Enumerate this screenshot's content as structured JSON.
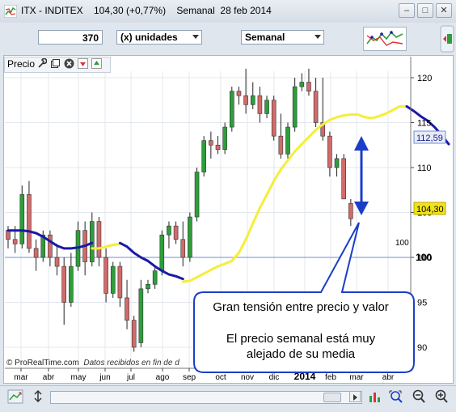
{
  "window": {
    "title": "ITX - INDITEX    104,30 (+0,77%)    Semanal  28 feb 2014",
    "minimize": "–",
    "maximize": "□",
    "close": "✕"
  },
  "toolbar": {
    "quantity": "370",
    "units_combo": "(x) unidades",
    "period_combo": "Semanal",
    "indicator_button_icon": "indicators-icon"
  },
  "panel": {
    "label": "Precio",
    "icons": [
      "wrench-icon",
      "window-icon",
      "close-icon",
      "arrow-down-icon",
      "arrow-up-icon"
    ]
  },
  "price_axis": {
    "ticks": [
      "120",
      "115",
      "110",
      "105",
      "100",
      "95",
      "90"
    ],
    "current_price_label": "104,30",
    "ma_label": "112,59",
    "ref_line_label": "100",
    "ref_line_label_right": "100"
  },
  "time_axis": {
    "labels": [
      "mar",
      "abr",
      "may",
      "jun",
      "jul",
      "ago",
      "sep",
      "oct",
      "nov",
      "dic",
      "2014",
      "feb",
      "mar",
      "abr"
    ]
  },
  "copyright": {
    "brand": "© ProRealTime.com",
    "note": "Datos recibidos en fin de d"
  },
  "callout": {
    "line1": "Gran tensión entre precio y valor",
    "line2": "El precio semanal está muy",
    "line3": "alejado de su media"
  },
  "colors": {
    "bull": "#2e9e3a",
    "bear": "#d26a6a",
    "ma_blue": "#1a1aa6",
    "ma_yellow": "#f5ee3a",
    "arrow": "#1a3ec8",
    "ref_line": "#6f8fd6"
  },
  "chart_data": {
    "type": "candlestick",
    "title": "ITX - INDITEX",
    "ylim": [
      88,
      122
    ],
    "reference_level": 100,
    "candles": [
      {
        "o": 103.0,
        "h": 103.5,
        "l": 101.0,
        "c": 102.0
      },
      {
        "o": 102.0,
        "h": 103.5,
        "l": 100.5,
        "c": 101.5
      },
      {
        "o": 101.5,
        "h": 108.0,
        "l": 101.0,
        "c": 107.0
      },
      {
        "o": 107.0,
        "h": 108.5,
        "l": 100.5,
        "c": 101.0
      },
      {
        "o": 101.0,
        "h": 102.0,
        "l": 98.5,
        "c": 100.0
      },
      {
        "o": 100.0,
        "h": 103.0,
        "l": 99.5,
        "c": 102.5
      },
      {
        "o": 102.5,
        "h": 103.0,
        "l": 99.0,
        "c": 100.0
      },
      {
        "o": 100.0,
        "h": 101.5,
        "l": 98.0,
        "c": 99.0
      },
      {
        "o": 99.0,
        "h": 100.0,
        "l": 92.5,
        "c": 95.0
      },
      {
        "o": 95.0,
        "h": 100.5,
        "l": 94.5,
        "c": 99.0
      },
      {
        "o": 99.0,
        "h": 104.0,
        "l": 98.5,
        "c": 103.0
      },
      {
        "o": 103.0,
        "h": 104.0,
        "l": 98.0,
        "c": 99.5
      },
      {
        "o": 99.5,
        "h": 105.0,
        "l": 99.0,
        "c": 104.0
      },
      {
        "o": 104.0,
        "h": 104.5,
        "l": 99.0,
        "c": 100.0
      },
      {
        "o": 100.0,
        "h": 101.0,
        "l": 95.0,
        "c": 96.0
      },
      {
        "o": 96.0,
        "h": 99.5,
        "l": 95.5,
        "c": 99.0
      },
      {
        "o": 99.0,
        "h": 99.5,
        "l": 94.5,
        "c": 95.5
      },
      {
        "o": 95.5,
        "h": 97.5,
        "l": 92.0,
        "c": 93.0
      },
      {
        "o": 93.0,
        "h": 93.5,
        "l": 89.5,
        "c": 90.0
      },
      {
        "o": 90.5,
        "h": 97.5,
        "l": 90.0,
        "c": 96.5
      },
      {
        "o": 96.5,
        "h": 97.5,
        "l": 96.0,
        "c": 97.0
      },
      {
        "o": 97.0,
        "h": 99.0,
        "l": 96.5,
        "c": 98.5
      },
      {
        "o": 98.5,
        "h": 103.0,
        "l": 98.0,
        "c": 102.5
      },
      {
        "o": 102.5,
        "h": 104.0,
        "l": 101.0,
        "c": 103.5
      },
      {
        "o": 103.5,
        "h": 104.0,
        "l": 101.5,
        "c": 102.0
      },
      {
        "o": 102.0,
        "h": 104.0,
        "l": 99.0,
        "c": 100.0
      },
      {
        "o": 100.0,
        "h": 105.0,
        "l": 99.5,
        "c": 104.5
      },
      {
        "o": 104.5,
        "h": 110.0,
        "l": 104.0,
        "c": 109.5
      },
      {
        "o": 109.5,
        "h": 113.5,
        "l": 109.0,
        "c": 113.0
      },
      {
        "o": 113.0,
        "h": 114.0,
        "l": 111.0,
        "c": 112.5
      },
      {
        "o": 112.5,
        "h": 113.5,
        "l": 111.5,
        "c": 112.0
      },
      {
        "o": 112.0,
        "h": 115.0,
        "l": 111.5,
        "c": 114.5
      },
      {
        "o": 114.5,
        "h": 119.0,
        "l": 114.0,
        "c": 118.5
      },
      {
        "o": 118.5,
        "h": 119.0,
        "l": 117.0,
        "c": 118.0
      },
      {
        "o": 118.0,
        "h": 121.0,
        "l": 116.0,
        "c": 117.0
      },
      {
        "o": 117.0,
        "h": 119.5,
        "l": 116.5,
        "c": 118.0
      },
      {
        "o": 118.0,
        "h": 119.0,
        "l": 115.0,
        "c": 116.0
      },
      {
        "o": 116.0,
        "h": 118.0,
        "l": 115.5,
        "c": 117.5
      },
      {
        "o": 117.5,
        "h": 118.0,
        "l": 113.0,
        "c": 113.5
      },
      {
        "o": 113.5,
        "h": 116.0,
        "l": 111.0,
        "c": 111.5
      },
      {
        "o": 111.5,
        "h": 115.0,
        "l": 111.0,
        "c": 114.5
      },
      {
        "o": 114.5,
        "h": 120.0,
        "l": 114.0,
        "c": 119.0
      },
      {
        "o": 119.0,
        "h": 120.5,
        "l": 118.5,
        "c": 119.5
      },
      {
        "o": 119.5,
        "h": 121.0,
        "l": 118.0,
        "c": 118.5
      },
      {
        "o": 118.5,
        "h": 120.0,
        "l": 114.5,
        "c": 115.0
      },
      {
        "o": 115.0,
        "h": 120.0,
        "l": 113.0,
        "c": 113.5
      },
      {
        "o": 113.5,
        "h": 114.0,
        "l": 109.0,
        "c": 110.0
      },
      {
        "o": 110.0,
        "h": 111.5,
        "l": 109.0,
        "c": 111.0
      },
      {
        "o": 111.0,
        "h": 111.5,
        "l": 106.5,
        "c": 106.5
      },
      {
        "o": 106.0,
        "h": 106.5,
        "l": 103.5,
        "c": 104.3
      }
    ],
    "ma_segments": [
      {
        "color": "blue",
        "values": [
          103.0,
          103.0,
          103.0,
          102.9,
          102.7,
          102.3,
          101.8,
          101.3,
          101.0,
          101.0,
          101.1,
          101.3,
          101.6
        ]
      },
      {
        "color": "yellow",
        "values": [
          101.0,
          101.0,
          101.2,
          101.4,
          101.5
        ]
      },
      {
        "color": "blue",
        "values": [
          101.6,
          101.2,
          100.5,
          100.0,
          99.6,
          99.0,
          98.5,
          98.1,
          97.9,
          97.6
        ]
      },
      {
        "color": "yellow",
        "values": [
          97.3,
          97.4,
          97.8,
          98.2,
          98.6,
          99.0,
          99.3,
          99.6,
          100.5,
          102.0,
          103.8,
          105.5,
          107.0,
          108.5,
          109.8,
          110.8,
          111.8,
          112.6,
          113.4,
          114.2,
          114.8,
          115.3,
          115.6,
          115.8,
          115.9,
          115.9,
          115.6,
          115.5,
          115.7,
          116.0,
          116.4,
          116.8,
          116.8
        ]
      },
      {
        "color": "blue",
        "values": [
          116.8,
          116.3,
          115.7,
          115.2,
          114.5,
          113.6,
          112.6
        ]
      }
    ]
  }
}
